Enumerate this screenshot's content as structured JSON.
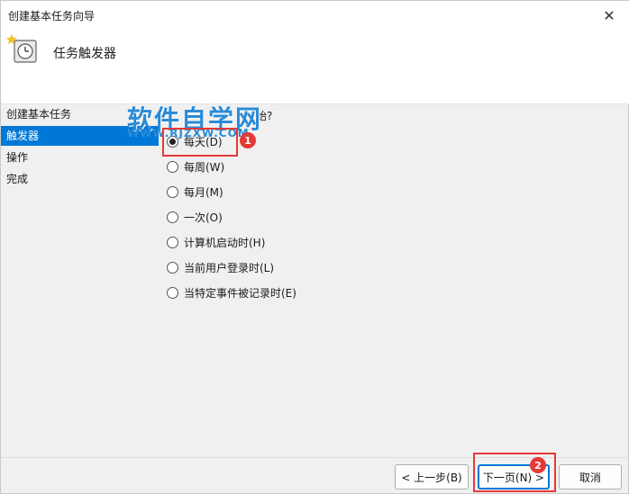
{
  "window": {
    "title": "创建基本任务向导",
    "close_glyph": "✕"
  },
  "header": {
    "title": "任务触发器",
    "icon": "clock-icon"
  },
  "sidebar": {
    "items": [
      {
        "label": "创建基本任务",
        "active": false
      },
      {
        "label": "触发器",
        "active": true
      },
      {
        "label": "操作",
        "active": false
      },
      {
        "label": "完成",
        "active": false
      }
    ]
  },
  "main": {
    "question": "始?",
    "options": [
      {
        "label": "每天(D)",
        "checked": true
      },
      {
        "label": "每周(W)",
        "checked": false
      },
      {
        "label": "每月(M)",
        "checked": false
      },
      {
        "label": "一次(O)",
        "checked": false
      },
      {
        "label": "计算机启动时(H)",
        "checked": false
      },
      {
        "label": "当前用户登录时(L)",
        "checked": false
      },
      {
        "label": "当特定事件被记录时(E)",
        "checked": false
      }
    ]
  },
  "watermark": {
    "text": "软件自学网",
    "sub": "WWW.RJZXW.COM"
  },
  "annotations": {
    "badge1": "1",
    "badge2": "2",
    "color": "#e53935"
  },
  "buttons": {
    "back": "< 上一步(B)",
    "next": "下一页(N) >",
    "cancel": "取消"
  },
  "colors": {
    "accent": "#0078d7"
  }
}
